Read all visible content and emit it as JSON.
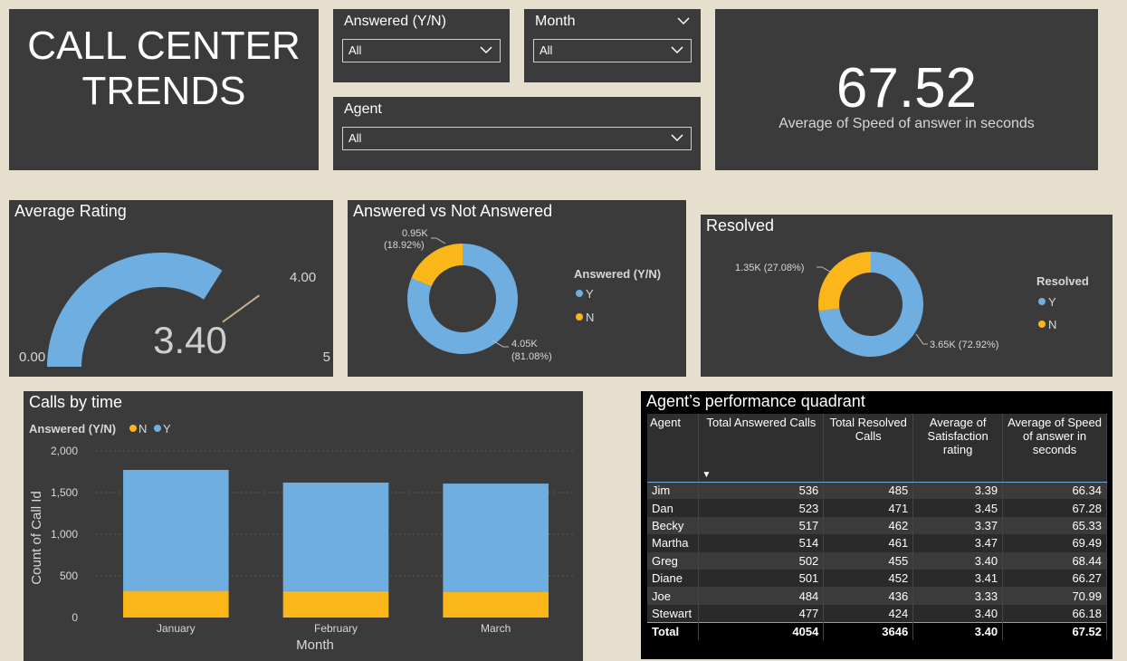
{
  "title": "CALL CENTER\nTRENDS",
  "slicers": {
    "answered": {
      "label": "Answered (Y/N)",
      "value": "All"
    },
    "month": {
      "label": "Month",
      "value": "All"
    },
    "agent": {
      "label": "Agent",
      "value": "All"
    }
  },
  "kpi": {
    "value": "67.52",
    "label": "Average of Speed of answer in seconds"
  },
  "gauge": {
    "title": "Average Rating",
    "value": 3.4,
    "value_label": "3.40",
    "min": 0,
    "min_label": "0.00",
    "max": 5,
    "max_label": "5",
    "target": 4,
    "target_label": "4.00"
  },
  "colors": {
    "Y": "#6eaee0",
    "N": "#fbb619",
    "panel": "#3b3b3b",
    "background": "#e6dfcd"
  },
  "chart_data": [
    {
      "type": "pie",
      "title": "Answered vs Not Answered",
      "legend_title": "Answered (Y/N)",
      "legend_position": "right",
      "labels": [
        "Y",
        "N"
      ],
      "values": [
        4054,
        946
      ],
      "data_labels": [
        [
          "4.05K",
          "(81.08%)"
        ],
        [
          "0.95K",
          "(18.92%)"
        ]
      ]
    },
    {
      "type": "pie",
      "title": "Resolved",
      "legend_title": "Resolved",
      "legend_position": "right",
      "labels": [
        "Y",
        "N"
      ],
      "values": [
        3646,
        1354
      ],
      "data_labels": [
        "3.65K (72.92%)",
        "1.35K (27.08%)"
      ]
    },
    {
      "type": "bar",
      "title": "Calls by time",
      "legend_title": "Answered (Y/N)",
      "legend_position": "top-left",
      "categories": [
        "January",
        "February",
        "March"
      ],
      "series": [
        {
          "name": "N",
          "values": [
            320,
            317,
            309
          ]
        },
        {
          "name": "Y",
          "values": [
            1452,
            1303,
            1299
          ]
        }
      ],
      "xlabel": "Month",
      "ylabel": "Count of Call Id",
      "ylim": [
        0,
        2000
      ],
      "yticks": [
        0,
        500,
        1000,
        1500,
        2000
      ],
      "ytick_labels": [
        "0",
        "500",
        "1,000",
        "1,500",
        "2,000"
      ],
      "grid": true
    }
  ],
  "matrix": {
    "title": "Agent’s performance quadrant",
    "headers": [
      "Agent",
      "Total Answered Calls",
      "Total Resolved Calls",
      "Average of Satisfaction rating",
      "Average of Speed of answer in seconds"
    ],
    "rows": [
      [
        "Jim",
        "536",
        "485",
        "3.39",
        "66.34"
      ],
      [
        "Dan",
        "523",
        "471",
        "3.45",
        "67.28"
      ],
      [
        "Becky",
        "517",
        "462",
        "3.37",
        "65.33"
      ],
      [
        "Martha",
        "514",
        "461",
        "3.47",
        "69.49"
      ],
      [
        "Greg",
        "502",
        "455",
        "3.40",
        "68.44"
      ],
      [
        "Diane",
        "501",
        "452",
        "3.41",
        "66.27"
      ],
      [
        "Joe",
        "484",
        "436",
        "3.33",
        "70.99"
      ],
      [
        "Stewart",
        "477",
        "424",
        "3.40",
        "66.18"
      ]
    ],
    "total": [
      "Total",
      "4054",
      "3646",
      "3.40",
      "67.52"
    ]
  }
}
